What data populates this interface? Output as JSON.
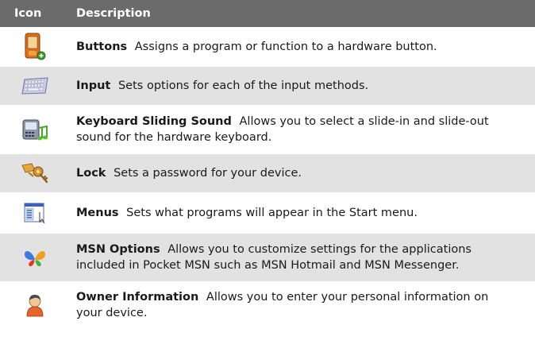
{
  "header": {
    "icon_col": "Icon",
    "desc_col": "Description"
  },
  "rows": [
    {
      "name": "Buttons",
      "text": "Assigns a program or function to a hardware button.",
      "icon": "buttons-icon"
    },
    {
      "name": "Input",
      "text": "Sets options for each of the input methods.",
      "icon": "keyboard-icon"
    },
    {
      "name": "Keyboard Sliding Sound",
      "text": "Allows you to select a slide-in and slide-out sound for the hardware keyboard.",
      "icon": "sliding-sound-icon"
    },
    {
      "name": "Lock",
      "text": "Sets a password for your device.",
      "icon": "lock-keys-icon"
    },
    {
      "name": "Menus",
      "text": "Sets what programs will appear in the Start menu.",
      "icon": "menus-icon"
    },
    {
      "name": "MSN Options",
      "text": "Allows you to customize settings for the applications included in Pocket MSN such as MSN Hotmail and MSN Messenger.",
      "icon": "msn-butterfly-icon"
    },
    {
      "name": "Owner Information",
      "text": "Allows you to enter your personal information on your device.",
      "icon": "owner-person-icon"
    }
  ]
}
